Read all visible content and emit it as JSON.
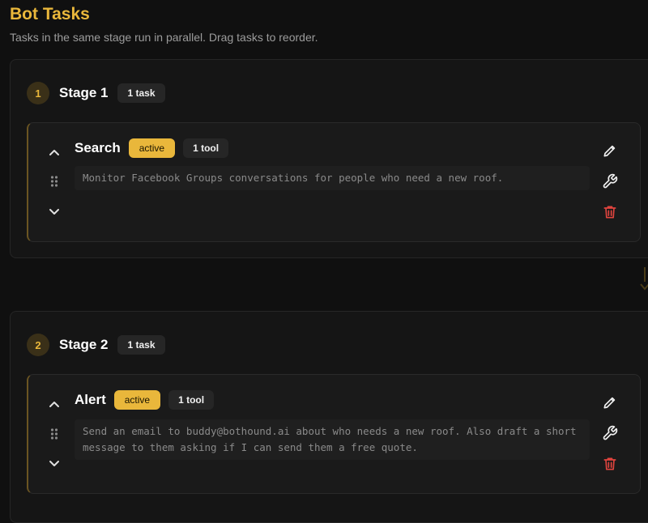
{
  "page": {
    "title": "Bot Tasks",
    "subtitle": "Tasks in the same stage run in parallel. Drag tasks to reorder."
  },
  "stages": [
    {
      "number": "1",
      "name": "Stage 1",
      "task_count": "1 task",
      "tasks": [
        {
          "name": "Search",
          "status": "active",
          "tool_count": "1 tool",
          "description": "Monitor Facebook Groups conversations for people who need a new roof."
        }
      ]
    },
    {
      "number": "2",
      "name": "Stage 2",
      "task_count": "1 task",
      "tasks": [
        {
          "name": "Alert",
          "status": "active",
          "tool_count": "1 tool",
          "description": "Send an email to buddy@bothound.ai about who needs a new roof. Also draft a short message to them asking if I can send them a free quote."
        }
      ]
    }
  ],
  "icons": {
    "collapse": "chevron-up-icon",
    "expand": "chevron-down-icon",
    "drag": "drag-handle-icon",
    "edit": "pencil-icon",
    "tools": "wrench-icon",
    "delete": "trash-icon",
    "connector": "arrow-down-icon"
  },
  "colors": {
    "accent": "#e9b73b",
    "background": "#101010",
    "card": "#151515",
    "task_card": "#1a1a1a",
    "danger": "#e0443e",
    "muted_text": "#9c9c9c"
  }
}
